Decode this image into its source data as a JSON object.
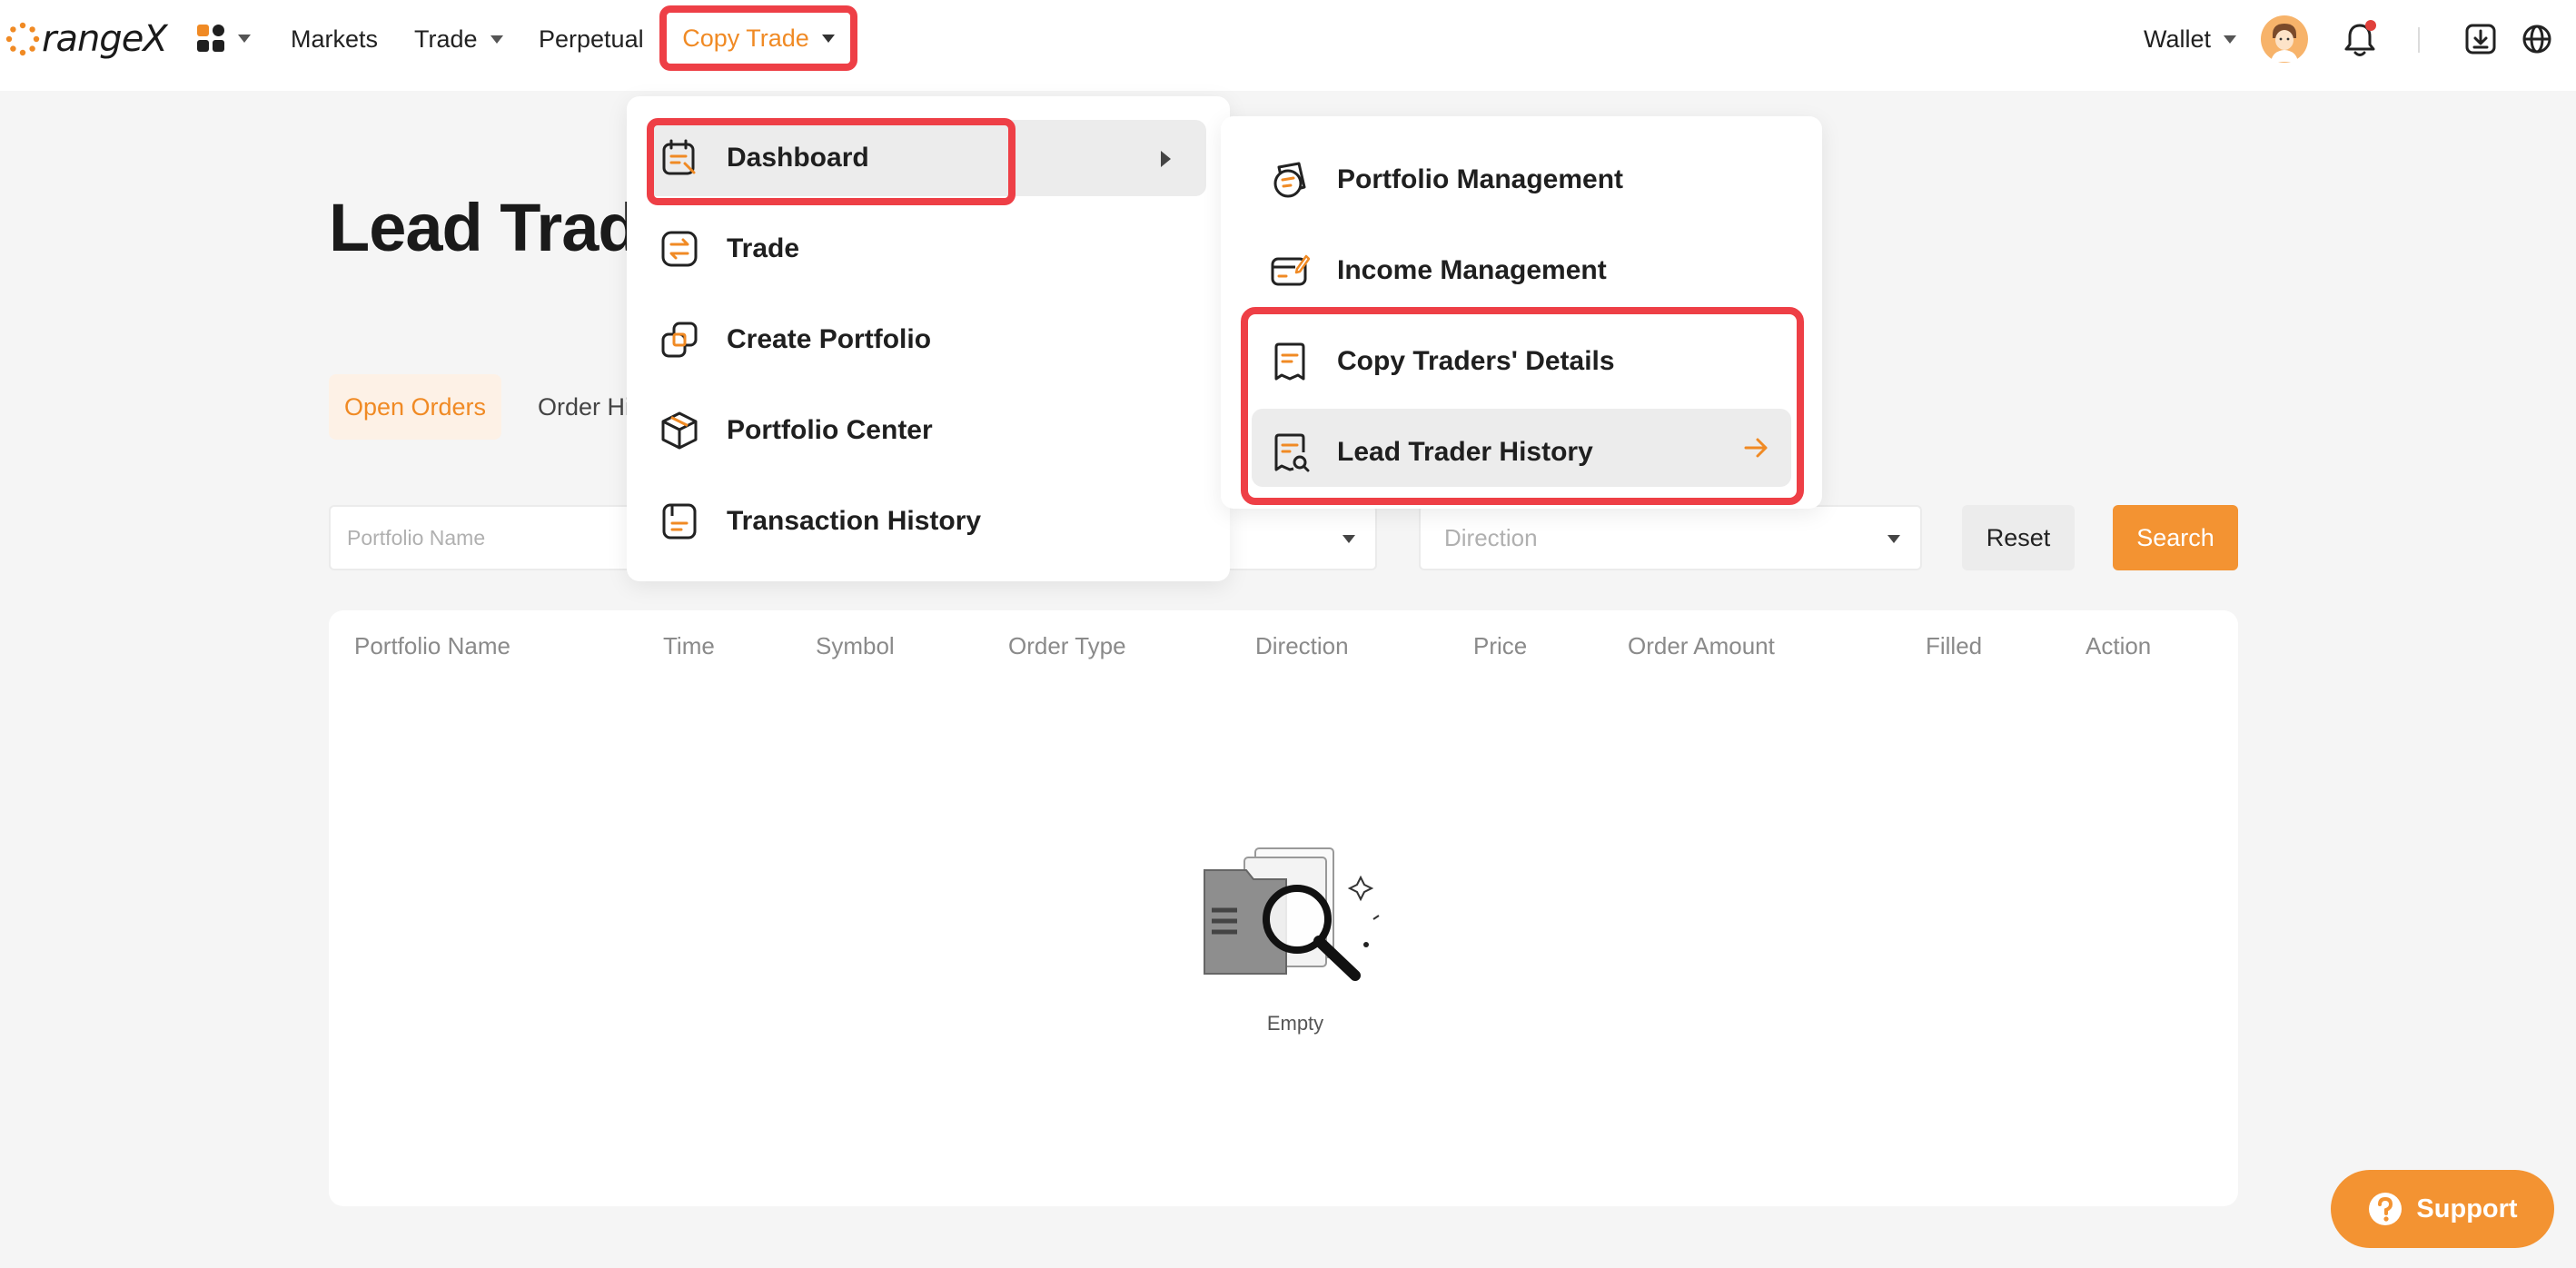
{
  "header": {
    "logo_text": "rangeX",
    "nav": {
      "markets": "Markets",
      "trade": "Trade",
      "perpetual": "Perpetual",
      "copy_trade": "Copy Trade"
    },
    "wallet": "Wallet"
  },
  "page": {
    "title": "Lead Trade",
    "tabs": {
      "open_orders": "Open Orders",
      "order_history": "Order Hi"
    },
    "filters": {
      "portfolio_placeholder": "Portfolio Name",
      "direction_placeholder": "Direction",
      "reset": "Reset",
      "search": "Search"
    },
    "table": {
      "columns": [
        "Portfolio Name",
        "Time",
        "Symbol",
        "Order Type",
        "Direction",
        "Price",
        "Order Amount",
        "Filled",
        "Action"
      ],
      "empty": "Empty"
    }
  },
  "menu": {
    "left": [
      "Dashboard",
      "Trade",
      "Create Portfolio",
      "Portfolio Center",
      "Transaction History"
    ],
    "right": [
      "Portfolio Management",
      "Income Management",
      "Copy Traders' Details",
      "Lead Trader History"
    ]
  },
  "support": "Support",
  "colors": {
    "accent": "#f39332",
    "highlight": "#ee3f46"
  }
}
